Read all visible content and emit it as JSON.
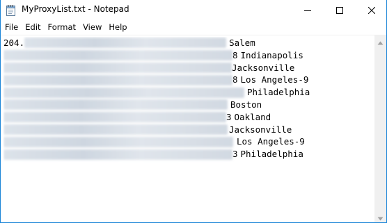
{
  "window": {
    "title": "MyProxyList.txt - Notepad",
    "accent_color": "#1883d7",
    "icons": {
      "app": "notepad-icon",
      "minimize": "minimize-icon",
      "maximize": "maximize-icon",
      "close": "close-icon"
    }
  },
  "menu": {
    "items": [
      "File",
      "Edit",
      "Format",
      "View",
      "Help"
    ]
  },
  "document": {
    "lines": [
      {
        "visible_prefix": "204.",
        "tail": "",
        "city": "Salem"
      },
      {
        "visible_prefix": "",
        "tail": "8",
        "city": "Indianapolis"
      },
      {
        "visible_prefix": "",
        "tail": "",
        "city": "Jacksonville"
      },
      {
        "visible_prefix": "",
        "tail": "8",
        "city": "Los Angeles-9"
      },
      {
        "visible_prefix": "",
        "tail": "",
        "city": "Philadelphia"
      },
      {
        "visible_prefix": "",
        "tail": "",
        "city": "Boston"
      },
      {
        "visible_prefix": "",
        "tail": "3",
        "city": "Oakland"
      },
      {
        "visible_prefix": "",
        "tail": "",
        "city": "Jacksonville"
      },
      {
        "visible_prefix": "",
        "tail": "",
        "city": "Los Angeles-9"
      },
      {
        "visible_prefix": "",
        "tail": "3",
        "city": "Philadelphia"
      }
    ]
  }
}
